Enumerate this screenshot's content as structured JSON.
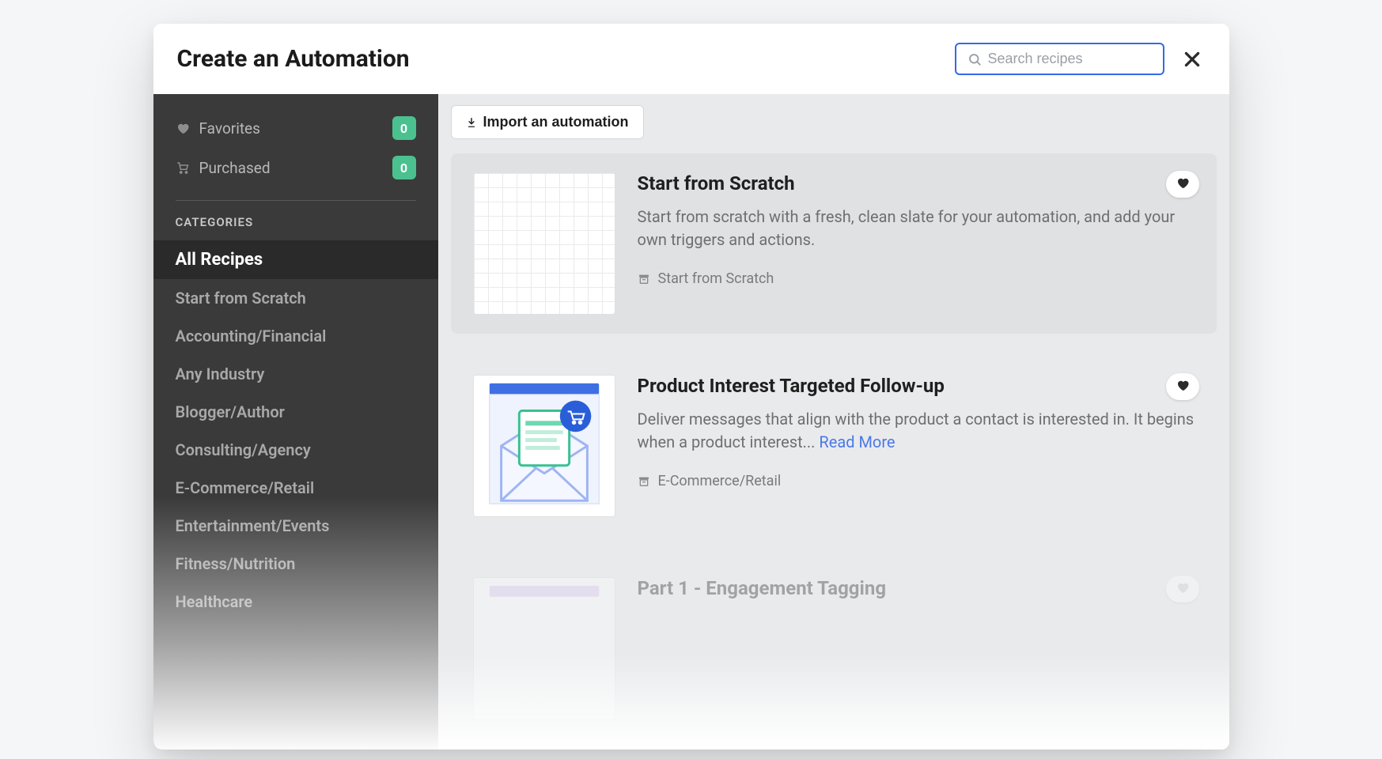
{
  "header": {
    "title": "Create an Automation",
    "search_placeholder": "Search recipes"
  },
  "sidebar": {
    "favorites_label": "Favorites",
    "favorites_count": "0",
    "purchased_label": "Purchased",
    "purchased_count": "0",
    "categories_heading": "CATEGORIES",
    "items": [
      {
        "label": "All Recipes",
        "active": true
      },
      {
        "label": "Start from Scratch"
      },
      {
        "label": "Accounting/Financial"
      },
      {
        "label": "Any Industry"
      },
      {
        "label": "Blogger/Author"
      },
      {
        "label": "Consulting/Agency"
      },
      {
        "label": "E-Commerce/Retail"
      },
      {
        "label": "Entertainment/Events"
      },
      {
        "label": "Fitness/Nutrition"
      },
      {
        "label": "Healthcare"
      }
    ]
  },
  "main": {
    "import_label": "Import an automation",
    "read_more_label": "Read More",
    "cards": [
      {
        "title": "Start from Scratch",
        "desc": "Start from scratch with a fresh, clean slate for your automation, and add your own triggers and actions.",
        "category": "Start from Scratch"
      },
      {
        "title": "Product Interest Targeted Follow-up",
        "desc": "Deliver messages that align with the product a contact is interested in. It begins when a product interest... ",
        "category": "E-Commerce/Retail"
      },
      {
        "title": "Part 1 - Engagement Tagging",
        "desc": "",
        "category": ""
      }
    ]
  }
}
